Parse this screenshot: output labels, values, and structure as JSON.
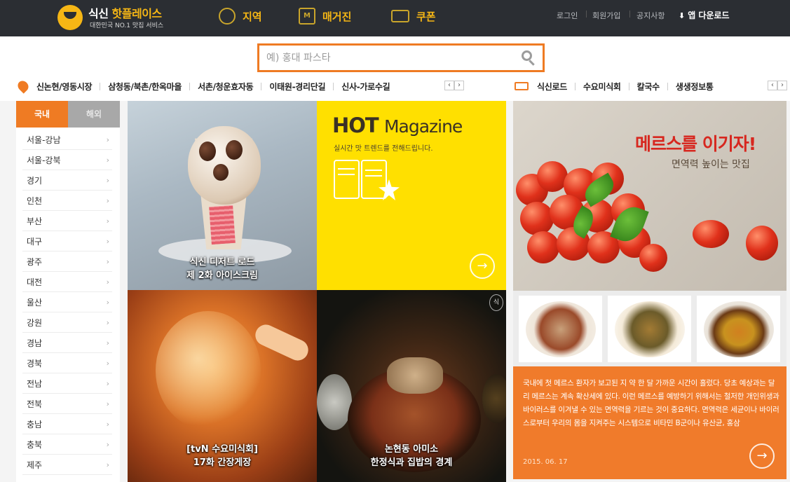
{
  "header": {
    "logo_title_white": "식신",
    "logo_title_orange": "핫플레이스",
    "logo_sub": "대한민국 NO.1 맛집 서비스",
    "nav": [
      {
        "label": "지역",
        "icon": "compass-icon"
      },
      {
        "label": "매거진",
        "icon": "magazine-icon",
        "icon_letter": "M"
      },
      {
        "label": "쿠폰",
        "icon": "coupon-icon"
      }
    ],
    "utils": [
      "로그인",
      "회원가입",
      "공지사항"
    ],
    "app_download": "앱 다운로드"
  },
  "search": {
    "placeholder": "예) 홍대 파스타"
  },
  "quick_areas": [
    "신논현/영동시장",
    "삼청동/북촌/한옥마을",
    "서촌/청운효자동",
    "이태원-경리단길",
    "신사-가로수길"
  ],
  "quick_themes": [
    "식신로드",
    "수요미식회",
    "칼국수",
    "생생정보통"
  ],
  "pager": {
    "prev": "‹",
    "next": "›"
  },
  "regions": {
    "tabs": [
      "국내",
      "해외"
    ],
    "items": [
      "서울-강남",
      "서울-강북",
      "경기",
      "인천",
      "부산",
      "대구",
      "광주",
      "대전",
      "울산",
      "강원",
      "경남",
      "경북",
      "전남",
      "전북",
      "충남",
      "충북",
      "제주"
    ]
  },
  "tiles": {
    "icecream": {
      "line1": "식신 디저트 로드",
      "line2": "제 2화 아이스크림"
    },
    "hot": {
      "title_bold": "HOT",
      "title_rest": "Magazine",
      "subtitle": "실시간 맛 트렌드를 전해드립니다."
    },
    "crab": {
      "line1": "[tvN 수요미식회]",
      "line2": "17화 간장게장"
    },
    "soup": {
      "line1": "논현동 아미소",
      "line2": "한정식과 집밥의 경계",
      "badge": "식"
    },
    "mers": {
      "headline": "메르스를 이기자!",
      "subhead": "면역력 높이는 맛집",
      "text": "국내에 첫 메르스 환자가 보고된 지 약 한 달 가까운 시간이 흘렀다. 당초 예상과는 달리 메르스는 계속 확산세에 있다. 이런 메르스를 예방하기 위해서는 철저한 개인위생과 바이러스를 이겨낼 수 있는 면역력을 기르는 것이 중요하다. 면역력은 세균이나 바이러스로부터 우리의 몸을 지켜주는 시스템으로 비타민 B군이나 유산균, 홍삼",
      "date": "2015. 06. 17"
    }
  },
  "colors": {
    "accent": "#ef7b23",
    "topbar": "#2b2e33",
    "hot_yellow": "#ffe000",
    "logo_yellow": "#f5b615"
  }
}
